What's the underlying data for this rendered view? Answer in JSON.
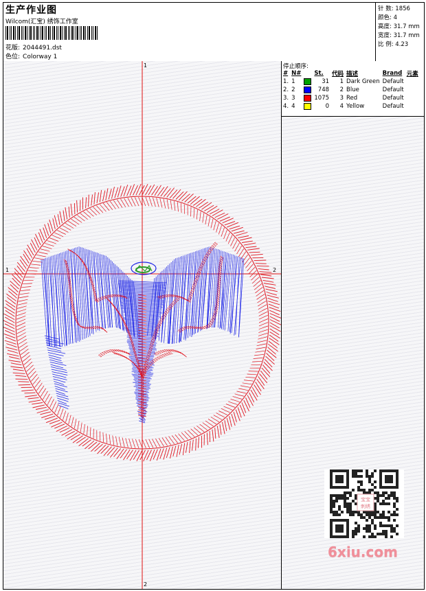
{
  "header": {
    "title": "生产作业图",
    "company": "Wilcom(汇宝) 绣饰工作室",
    "design_label": "花版:",
    "design_value": "2044491.dst",
    "colorway_label": "色位:",
    "colorway_value": "Colorway 1"
  },
  "specs": {
    "stitches_label": "针 数:",
    "stitches_value": "1856",
    "colors_label": "颜色:",
    "colors_value": "4",
    "height_label": "高度:",
    "height_value": "31.7 mm",
    "width_label": "宽度:",
    "width_value": "31.7 mm",
    "ratio_label": "比 例:",
    "ratio_value": "4.23"
  },
  "stop_sequence": {
    "title": "停止顺序:",
    "columns": [
      "#",
      "N#",
      "St.",
      "代码",
      "描述",
      "Brand",
      "元素"
    ],
    "rows": [
      {
        "idx": "1.",
        "n": "1",
        "color": "#00a000",
        "stitches": "31",
        "code": "1",
        "desc": "Dark Green",
        "brand": "Default"
      },
      {
        "idx": "2.",
        "n": "2",
        "color": "#0000ff",
        "stitches": "748",
        "code": "2",
        "desc": "Blue",
        "brand": "Default"
      },
      {
        "idx": "3.",
        "n": "3",
        "color": "#ff0000",
        "stitches": "1075",
        "code": "3",
        "desc": "Red",
        "brand": "Default"
      },
      {
        "idx": "4.",
        "n": "4",
        "color": "#ffff00",
        "stitches": "0",
        "code": "4",
        "desc": "Yellow",
        "brand": "Default"
      }
    ]
  },
  "axes": {
    "top": "1",
    "bottom": "2",
    "left": "1",
    "right": "2"
  },
  "watermark": {
    "brand": "6xiu.com",
    "qr_stamp_lines": [
      "宝宝",
      "刺绣"
    ]
  },
  "colors": {
    "red_thread": "#e0141e",
    "blue_thread": "#1a22e6",
    "green_thread": "#2a9a2a",
    "crosshair": "#e01010"
  }
}
